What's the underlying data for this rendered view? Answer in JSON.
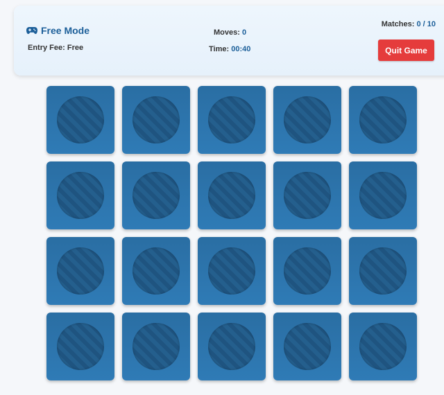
{
  "header": {
    "mode_icon": "gamepad-icon",
    "mode_label": "Free Mode",
    "entry_label": "Entry Fee:",
    "entry_value": "Free",
    "moves_label": "Moves:",
    "moves_value": "0",
    "time_label": "Time:",
    "time_value": "00:40",
    "matches_label": "Matches:",
    "matches_value": "0 / 10",
    "quit_label": "Quit Game"
  },
  "board": {
    "rows": 4,
    "columns": 5,
    "cards_face_down": 20
  },
  "colors": {
    "accent": "#1c5f99",
    "quit_button": "#e53c3c",
    "card": "#2a6ea3"
  }
}
